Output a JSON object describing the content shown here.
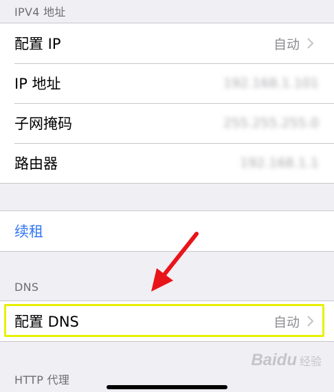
{
  "ipv4_section": {
    "header": "IPV4 地址",
    "rows": [
      {
        "label": "配置 IP",
        "value": "自动"
      },
      {
        "label": "IP 地址",
        "value": "192.168.1.101"
      },
      {
        "label": "子网掩码",
        "value": "255.255.255.0"
      },
      {
        "label": "路由器",
        "value": "192.168.1.1"
      }
    ]
  },
  "renew_lease": {
    "label": "续租"
  },
  "dns_section": {
    "header": "DNS",
    "rows": [
      {
        "label": "配置 DNS",
        "value": "自动"
      }
    ]
  },
  "http_proxy_section": {
    "header": "HTTP 代理"
  },
  "watermark": {
    "brand": "Baidu",
    "sub": "经验"
  },
  "colors": {
    "link": "#3478f6",
    "highlight": "#e9f000",
    "arrow": "#e8141a"
  }
}
